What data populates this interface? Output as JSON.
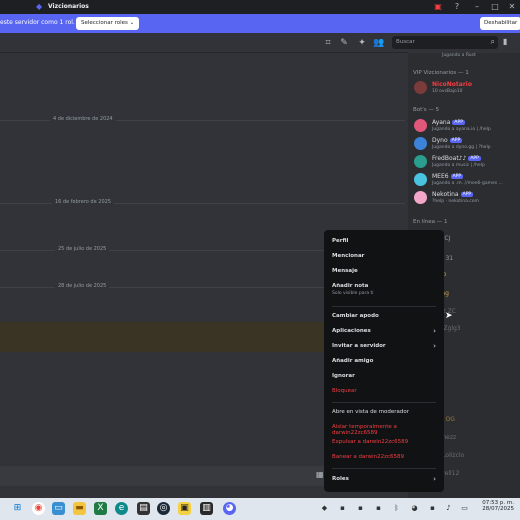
{
  "titlebar": {
    "title": "Vizcionarios"
  },
  "banner": {
    "message": "este servidor como 1 rol.",
    "roles_button": "Seleccionar roles",
    "disable_button": "Deshabilitar"
  },
  "header": {
    "search_placeholder": "Buscar"
  },
  "chat": {
    "dates": [
      "4 de diciembre de 2024",
      "16 de febrero de 2025",
      "25 de julio de 2025",
      "28 de julio de 2025"
    ]
  },
  "members": {
    "top_status": "Jugando a Rust",
    "vip_header": "VIP Vizcionarios — 1",
    "vip_member": {
      "name": "NicoNotario",
      "status": "10 ovsBajo10"
    },
    "bots_header": "Bot's — 5",
    "bots": [
      {
        "name": "Ayana",
        "badge": "APP",
        "status": "Jugando a ayana.io | /help",
        "color": "#e0577a"
      },
      {
        "name": "Dyno",
        "badge": "APP",
        "status": "Jugando a dyno.gg | ?help",
        "color": "#3c82d8"
      },
      {
        "name": "FredBoat♪♪",
        "badge": "APP",
        "status": "Jugando a music | /help",
        "color": "#2a9d8f"
      },
      {
        "name": "MEE6",
        "badge": "APP",
        "status": "Jugando a .m. //mee6-games ...",
        "color": "#49c3e0"
      },
      {
        "name": "Nekotina",
        "badge": "APP",
        "status": "?help · nekotina.com",
        "color": "#f3a6c8"
      }
    ],
    "online_header": "En línea — 1",
    "partial": [
      "eck CJ",
      "o — 31",
      "l.slto",
      "eKing",
      "Notz ZC",
      "o_ÖZglg3",
      "l.BV OG",
      "Gomezz",
      "thitLolizclo",
      "ldavell12"
    ]
  },
  "context_menu": {
    "profile": "Perfil",
    "mention": "Mencionar",
    "message": "Mensaje",
    "add_note": "Añadir nota",
    "add_note_sub": "Solo visible para ti",
    "change_nick": "Cambiar apodo",
    "apps": "Aplicaciones",
    "invite": "Invitar a servidor",
    "add_friend": "Añadir amigo",
    "ignore": "Ignorar",
    "block": "Bloquear",
    "mod_view": "Abre en vista de moderador",
    "timeout": "Aislar temporalmente a darwin22zc6589",
    "kick": "Expulsar a darwin22zc6589",
    "ban": "Banear a darwin22zc6589",
    "roles": "Roles"
  },
  "taskbar": {
    "time": "07:53 p. m.",
    "date": "28/07/2025"
  },
  "colors": {
    "blurple": "#5865f2",
    "danger": "#f23f43",
    "bg": "#313338"
  }
}
